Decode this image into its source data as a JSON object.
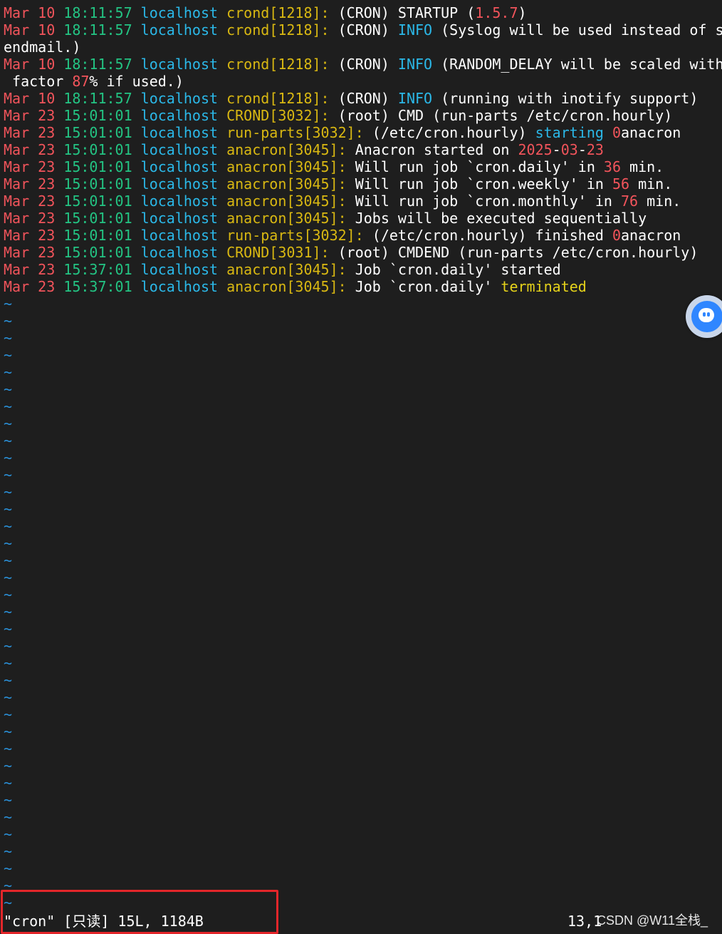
{
  "log_lines": [
    [
      "Mar",
      "10",
      "18:11:57",
      "localhost",
      "crond[1218]:",
      " (CRON) STARTUP (",
      "1.5.7",
      ")"
    ],
    [
      "Mar",
      "10",
      "18:11:57",
      "localhost",
      "crond[1218]:",
      " (CRON) ",
      "INFO",
      " (Syslog will be used instead of s"
    ],
    [
      "endmail.)"
    ],
    [
      "Mar",
      "10",
      "18:11:57",
      "localhost",
      "crond[1218]:",
      " (CRON) ",
      "INFO",
      " (RANDOM_DELAY will be scaled with"
    ],
    [
      " factor ",
      "87",
      "% if used.)"
    ],
    [
      "Mar",
      "10",
      "18:11:57",
      "localhost",
      "crond[1218]:",
      " (CRON) ",
      "INFO",
      " (running with inotify support)"
    ],
    [
      "Mar",
      "23",
      "15:01:01",
      "localhost",
      "CROND[3032]:",
      " (root) CMD (run-parts /etc/cron.hourly)"
    ],
    [
      "Mar",
      "23",
      "15:01:01",
      "localhost",
      "run-parts[3032]:",
      " (/etc/cron.hourly) ",
      "starting",
      " ",
      "0",
      "anacron"
    ],
    [
      "Mar",
      "23",
      "15:01:01",
      "localhost",
      "anacron[3045]:",
      " Anacron started on ",
      "2025",
      "-",
      "03",
      "-",
      "23"
    ],
    [
      "Mar",
      "23",
      "15:01:01",
      "localhost",
      "anacron[3045]:",
      " Will run job `cron.daily' in ",
      "36",
      " min."
    ],
    [
      "Mar",
      "23",
      "15:01:01",
      "localhost",
      "anacron[3045]:",
      " Will run job `cron.weekly' in ",
      "56",
      " min."
    ],
    [
      "Mar",
      "23",
      "15:01:01",
      "localhost",
      "anacron[3045]:",
      " Will run job `cron.monthly' in ",
      "76",
      " min."
    ],
    [
      "Mar",
      "23",
      "15:01:01",
      "localhost",
      "anacron[3045]:",
      " Jobs will be executed sequentially"
    ],
    [
      "Mar",
      "23",
      "15:01:01",
      "localhost",
      "run-parts[3032]:",
      " (/etc/cron.hourly) finished ",
      "0",
      "anacron"
    ],
    [
      "Mar",
      "23",
      "15:01:01",
      "localhost",
      "CROND[3031]:",
      " (root) CMDEND (run-parts /etc/cron.hourly)"
    ],
    [
      "Mar",
      "23",
      "15:37:01",
      "localhost",
      "anacron[3045]:",
      " Job `cron.daily' started"
    ],
    [
      "Mar",
      "23",
      "15:37:01",
      "localhost",
      "anacron[3045]:",
      " Job `cron.daily' ",
      "terminated"
    ]
  ],
  "tilde_char": "~",
  "tilde_count": 36,
  "status_line": "\"cron\" [只读] 15L, 1184B",
  "cursor_position": "13,1",
  "watermark": "CSDN @W11全栈_",
  "colors": {
    "background": "#1e1e1e",
    "date": "#f2545b",
    "time": "#23c483",
    "host": "#2bb8e8",
    "process": "#d9b812",
    "tilde": "#2a8fd6",
    "highlight_box": "#e3262a"
  },
  "icons": {
    "assistant": "assistant-face-icon"
  }
}
